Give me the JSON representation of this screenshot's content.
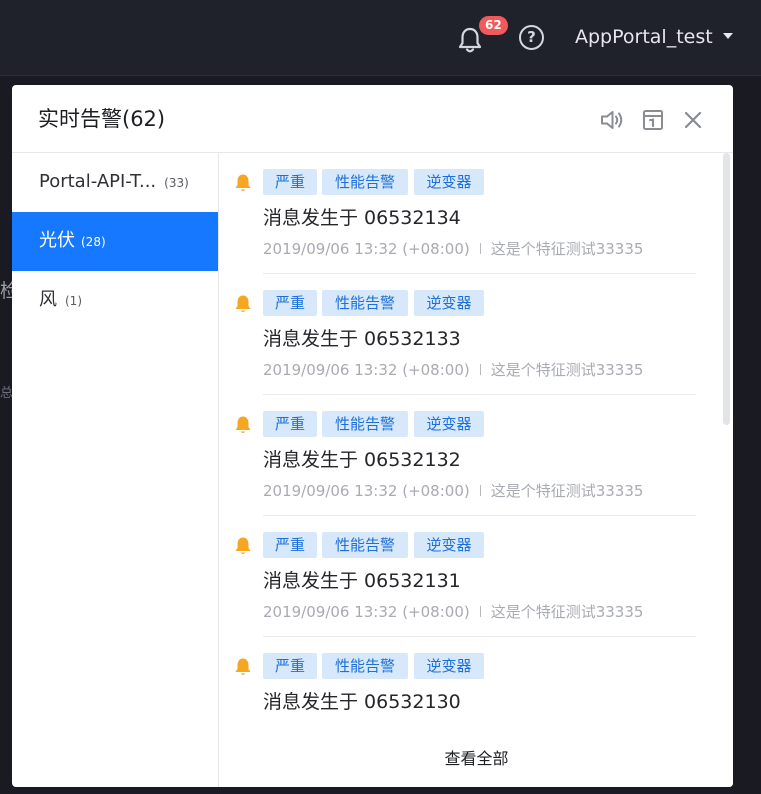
{
  "topbar": {
    "bell_icon": "bell-icon",
    "notification_count": "62",
    "help_icon": "question-circle-icon",
    "help_glyph": "?",
    "username": "AppPortal_test",
    "caret_icon": "caret-down-icon"
  },
  "background": {
    "glyph_1": "检",
    "glyph_2": "总"
  },
  "panel": {
    "title": "实时告警(62)",
    "sound_icon": "speaker-icon",
    "calendar_icon": "calendar-icon",
    "close_icon": "close-icon"
  },
  "sidebar": {
    "items": [
      {
        "label": "Portal-API-T...",
        "count": "(33)",
        "active": false
      },
      {
        "label": "光伏",
        "count": "(28)",
        "active": true
      },
      {
        "label": "风",
        "count": "(1)",
        "active": false
      }
    ]
  },
  "alerts": [
    {
      "tags": [
        "严重",
        "性能告警",
        "逆变器"
      ],
      "message": "消息发生于 06532134",
      "time": "2019/09/06 13:32 (+08:00)",
      "description": "这是个特征测试33335"
    },
    {
      "tags": [
        "严重",
        "性能告警",
        "逆变器"
      ],
      "message": "消息发生于 06532133",
      "time": "2019/09/06 13:32 (+08:00)",
      "description": "这是个特征测试33335"
    },
    {
      "tags": [
        "严重",
        "性能告警",
        "逆变器"
      ],
      "message": "消息发生于 06532132",
      "time": "2019/09/06 13:32 (+08:00)",
      "description": "这是个特征测试33335"
    },
    {
      "tags": [
        "严重",
        "性能告警",
        "逆变器"
      ],
      "message": "消息发生于 06532131",
      "time": "2019/09/06 13:32 (+08:00)",
      "description": "这是个特征测试33335"
    },
    {
      "tags": [
        "严重",
        "性能告警",
        "逆变器"
      ],
      "message": "消息发生于 06532130",
      "time": "",
      "description": ""
    }
  ],
  "footer": {
    "view_all": "查看全部"
  },
  "colors": {
    "accent": "#1677ff",
    "badge": "#f05a5a",
    "tag_bg": "#d7e8fb",
    "tag_text": "#1d6fd9",
    "alert_bell": "#f5a623"
  }
}
